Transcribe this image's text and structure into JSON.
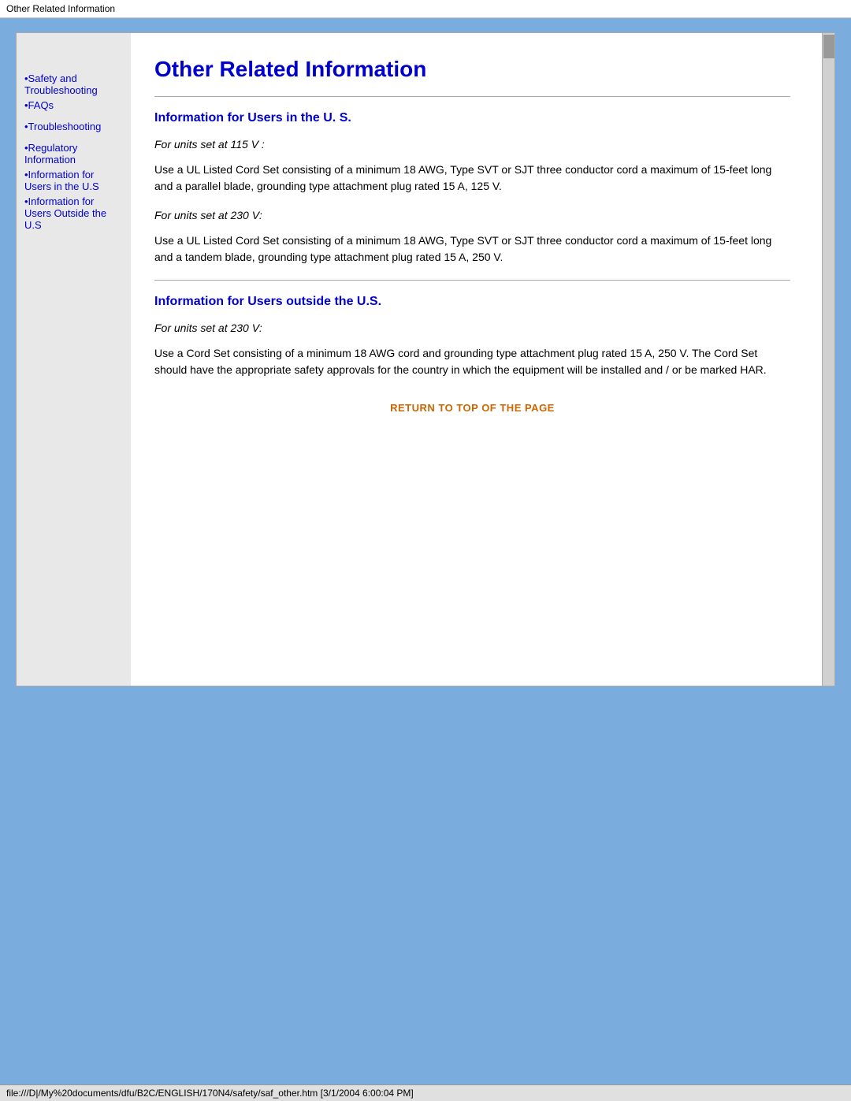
{
  "titlebar": {
    "text": "Other Related Information"
  },
  "statusbar": {
    "text": "file:///D|/My%20documents/dfu/B2C/ENGLISH/170N4/safety/saf_other.htm [3/1/2004 6:00:04 PM]"
  },
  "sidebar": {
    "links": [
      {
        "id": "safety-troubleshooting",
        "label": "•Safety and Troubleshooting"
      },
      {
        "id": "faqs",
        "label": "•FAQs"
      },
      {
        "id": "troubleshooting",
        "label": "•Troubleshooting"
      },
      {
        "id": "regulatory-info",
        "label": "•Regulatory Information"
      },
      {
        "id": "info-users-us",
        "label": "•Information for Users in the U.S"
      },
      {
        "id": "info-users-outside",
        "label": "•Information for Users Outside the U.S"
      }
    ]
  },
  "main": {
    "page_title": "Other Related Information",
    "section1": {
      "title": "Information for Users in the U. S.",
      "subsection1": {
        "heading": "For units set at 115 V :",
        "body": "Use a UL Listed Cord Set consisting of a minimum 18 AWG, Type SVT or SJT three conductor cord a maximum of 15-feet long and a parallel blade, grounding type attachment plug rated 15 A, 125 V."
      },
      "subsection2": {
        "heading": "For units set at 230 V:",
        "body": "Use a UL Listed Cord Set consisting of a minimum 18 AWG, Type SVT or SJT three conductor cord a maximum of 15-feet long and a tandem blade, grounding type attachment plug rated 15 A, 250 V."
      }
    },
    "section2": {
      "title": "Information for Users outside the U.S.",
      "subsection1": {
        "heading": "For units set at 230 V:",
        "body": "Use a Cord Set consisting of a minimum 18 AWG cord and grounding type attachment plug rated 15 A, 250 V. The Cord Set should have the appropriate safety approvals for the country in which the equipment will be installed and / or be marked HAR."
      }
    },
    "return_link": "RETURN TO TOP OF THE PAGE"
  }
}
